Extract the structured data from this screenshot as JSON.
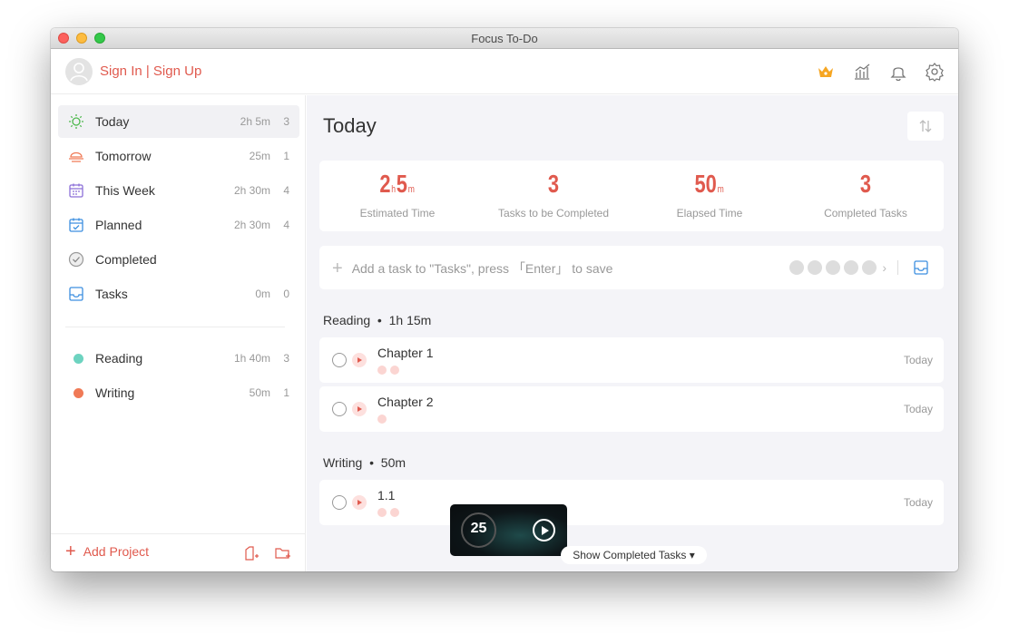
{
  "window": {
    "title": "Focus To-Do"
  },
  "header": {
    "signin_label": "Sign In | Sign Up"
  },
  "sidebar": {
    "items": [
      {
        "label": "Today",
        "time": "2h 5m",
        "count": "3"
      },
      {
        "label": "Tomorrow",
        "time": "25m",
        "count": "1"
      },
      {
        "label": "This Week",
        "time": "2h 30m",
        "count": "4"
      },
      {
        "label": "Planned",
        "time": "2h 30m",
        "count": "4"
      },
      {
        "label": "Completed",
        "time": "",
        "count": ""
      },
      {
        "label": "Tasks",
        "time": "0m",
        "count": "0"
      }
    ],
    "projects": [
      {
        "label": "Reading",
        "time": "1h 40m",
        "count": "3",
        "color": "#6dd3c0"
      },
      {
        "label": "Writing",
        "time": "50m",
        "count": "1",
        "color": "#f07a56"
      }
    ],
    "add_project_label": "Add Project"
  },
  "main": {
    "title": "Today",
    "stats": [
      {
        "label": "Estimated Time"
      },
      {
        "value": "3",
        "label": "Tasks to be Completed"
      },
      {
        "label": "Elapsed Time"
      },
      {
        "value": "3",
        "label": "Completed Tasks"
      }
    ],
    "estimated": {
      "h": "2",
      "h_unit": "h",
      "m": "5",
      "m_unit": "m"
    },
    "elapsed": {
      "m": "50",
      "m_unit": "m"
    },
    "add_task_placeholder": "Add a task to \"Tasks\", press 「Enter」 to save",
    "sections": [
      {
        "title": "Reading",
        "duration": "1h 15m"
      },
      {
        "title": "Writing",
        "duration": "50m"
      }
    ],
    "tasks": [
      {
        "name": "Chapter 1",
        "date": "Today",
        "pomodoros": 2
      },
      {
        "name": "Chapter 2",
        "date": "Today",
        "pomodoros": 1
      },
      {
        "name": "1.1",
        "date": "Today",
        "pomodoros": 2
      }
    ],
    "show_completed_label": "Show Completed Tasks ▾"
  },
  "timer": {
    "value": "25"
  },
  "colors": {
    "accent": "#e05a4e",
    "background": "#f4f4f8"
  },
  "icons": [
    "crown-icon",
    "chart-icon",
    "bell-icon",
    "gear-icon",
    "sun-icon",
    "sunset-icon",
    "calendar-week-icon",
    "calendar-planned-icon",
    "check-circle-icon",
    "inbox-icon"
  ]
}
